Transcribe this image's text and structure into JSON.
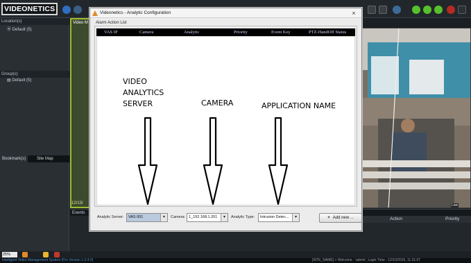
{
  "app": {
    "logo_text": "VIDEONETICS",
    "status_text": "Intelligent Video Management System (Pro Version 1.0.4.0)",
    "status_right": "[SITE_NAME] > Welcome - 'admin',  Login Time - 12/10/2016, 11:31:07",
    "zoom": "25%"
  },
  "left_panel": {
    "location_header": "Location(s)",
    "location_default": "Default (5)",
    "group_header": "Group(s)",
    "group_default": "Default (5)",
    "tabs": [
      "Bookmark(s)",
      "Site Map"
    ]
  },
  "video_left": {
    "label": "Video M",
    "timestamp": "12/13/"
  },
  "events": {
    "label": "Events",
    "columns": [
      "Action",
      "Priority"
    ]
  },
  "video_right": {
    "badge": "Live"
  },
  "dialog": {
    "title": "Videonetics - Analytic Configuration",
    "close_glyph": "×",
    "group_label": "Alarm Action List",
    "columns": [
      "VAS IP",
      "Camera",
      "Analytic",
      "Priority",
      "Event Key",
      "PTZ-HandOff Status"
    ],
    "annotations": {
      "server": [
        "VIDEO",
        "ANALYTICS",
        "SERVER"
      ],
      "camera": "CAMERA",
      "application": "APPLICATION NAME"
    },
    "form": {
      "server_label": "Analytic Server:",
      "server_value": "VAS 001",
      "camera_label": "Camera:",
      "camera_value": "1_192.168.1.201",
      "type_label": "Analytic Type:",
      "type_value": "Intrusion Detec...",
      "add_label": "Add new ...",
      "add_glyph": "+"
    }
  },
  "colors": {
    "accent_green": "#9bbd34",
    "table_header_bg": "#000000",
    "selected_combo": "#b9c9de"
  }
}
